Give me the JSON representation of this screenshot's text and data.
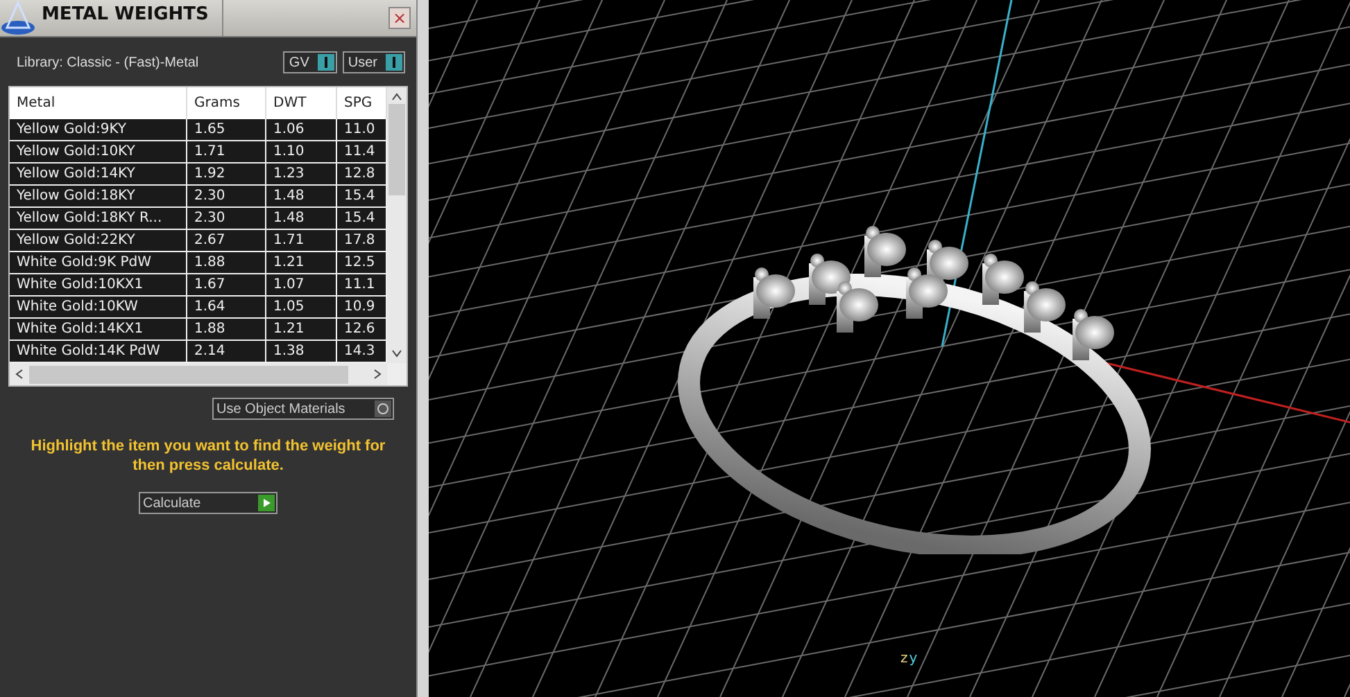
{
  "panel": {
    "title": "METAL WEIGHTS",
    "close": "×",
    "library": "Library: Classic - (Fast)-Metal",
    "toggles": [
      {
        "label": "GV",
        "on": true
      },
      {
        "label": "User",
        "on": true
      }
    ],
    "table": {
      "columns": [
        "Metal",
        "Grams",
        "DWT",
        "SPG"
      ],
      "rows": [
        [
          "Yellow Gold:9KY",
          "1.65",
          "1.06",
          "11.0"
        ],
        [
          "Yellow Gold:10KY",
          "1.71",
          "1.10",
          "11.4"
        ],
        [
          "Yellow Gold:14KY",
          "1.92",
          "1.23",
          "12.8"
        ],
        [
          "Yellow Gold:18KY",
          "2.30",
          "1.48",
          "15.4"
        ],
        [
          "Yellow Gold:18KY R...",
          "2.30",
          "1.48",
          "15.4"
        ],
        [
          "Yellow Gold:22KY",
          "2.67",
          "1.71",
          "17.8"
        ],
        [
          "White Gold:9K PdW",
          "1.88",
          "1.21",
          "12.5"
        ],
        [
          "White Gold:10KX1",
          "1.67",
          "1.07",
          "11.1"
        ],
        [
          "White Gold:10KW",
          "1.64",
          "1.05",
          "10.9"
        ],
        [
          "White Gold:14KX1",
          "1.88",
          "1.21",
          "12.6"
        ],
        [
          "White Gold:14K PdW",
          "2.14",
          "1.38",
          "14.3"
        ]
      ]
    },
    "option": {
      "label": "Use Object Materials",
      "on": false
    },
    "hint": "Highlight the item you want to find the weight for then press calculate.",
    "button": "Calculate"
  },
  "viewport": {
    "axis_labels": [
      "z",
      "y"
    ]
  }
}
